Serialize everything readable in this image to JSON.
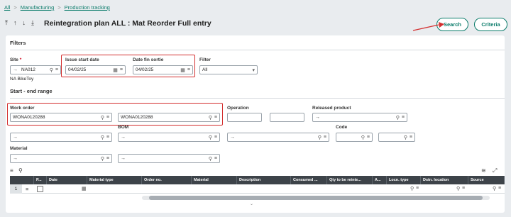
{
  "breadcrumb": {
    "items": [
      "All",
      "Manufacturing",
      "Production tracking"
    ],
    "sep": ">"
  },
  "header": {
    "title": "Reintegration plan ALL : Mat Reorder Full entry",
    "icons": [
      "first-icon",
      "up-icon",
      "down-icon",
      "last-icon"
    ]
  },
  "actions": {
    "search_label": "Search",
    "criteria_label": "Criteria"
  },
  "filters": {
    "section_title": "Filters",
    "site": {
      "label": "Site",
      "required_mark": "*",
      "value": "NA012",
      "desc": "NA BikeToy"
    },
    "issue_start_date": {
      "label": "Issue start date",
      "value": "04/02/25"
    },
    "date_fin_sortie": {
      "label": "Date fin sortie",
      "value": "04/02/25"
    },
    "filter": {
      "label": "Filter",
      "value": "All"
    }
  },
  "range": {
    "section_title": "Start - end range",
    "work_order": {
      "label": "Work order",
      "start": "WONA0120288",
      "end": "WONA0120288"
    },
    "operation": {
      "label": "Operation",
      "start": "",
      "end": ""
    },
    "released_product": {
      "label": "Released product",
      "start": "",
      "end": ""
    },
    "bom": {
      "label": "BOM",
      "start": "",
      "end": ""
    },
    "code": {
      "label": "Code",
      "start": "",
      "end": ""
    },
    "material": {
      "label": "Material",
      "start": "",
      "end": ""
    }
  },
  "table": {
    "columns": [
      "P...",
      "Date",
      "Material type",
      "Order no.",
      "Material",
      "Description",
      "Consumed ...",
      "Qty to be reinte...",
      "A...",
      "Locn. type",
      "Dstn. location",
      "Source"
    ],
    "row_number": "1"
  },
  "colors": {
    "accent": "#0a7b6a",
    "highlight": "#d32f2f",
    "table_header": "#3d4349"
  }
}
